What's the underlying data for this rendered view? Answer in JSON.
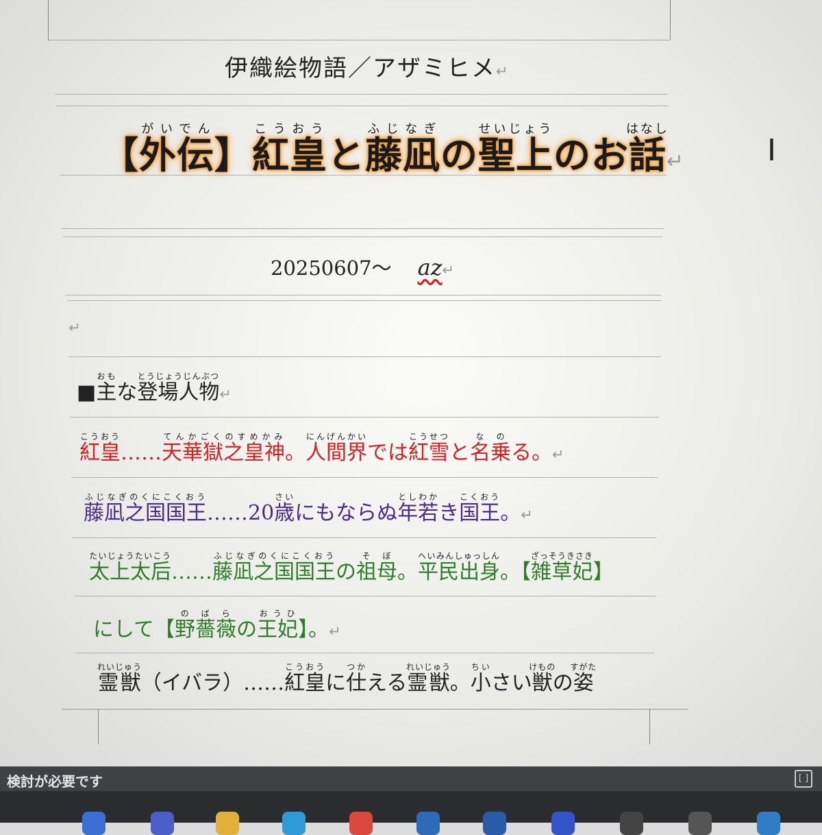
{
  "document": {
    "doc_title": "伊織絵物語／アザミヒメ",
    "heading": [
      {
        "text": "【",
        "ruby": ""
      },
      {
        "text": "外伝",
        "ruby": "がいでん"
      },
      {
        "text": "】",
        "ruby": ""
      },
      {
        "text": "紅皇",
        "ruby": "こうおう"
      },
      {
        "text": "と",
        "ruby": ""
      },
      {
        "text": "藤凪",
        "ruby": "ふじなぎ"
      },
      {
        "text": "の",
        "ruby": ""
      },
      {
        "text": "聖上",
        "ruby": "せいじょう"
      },
      {
        "text": "のお",
        "ruby": ""
      },
      {
        "text": "話",
        "ruby": "はなし"
      }
    ],
    "date": "20250607～",
    "author": "az",
    "paragraph_mark": "↵",
    "section_heading": [
      {
        "text": "■",
        "ruby": ""
      },
      {
        "text": "主",
        "ruby": "おも"
      },
      {
        "text": "な",
        "ruby": ""
      },
      {
        "text": "登場人物",
        "ruby": "とうじょうじんぶつ"
      }
    ],
    "rows": {
      "red": [
        {
          "text": "紅皇",
          "ruby": "こうおう"
        },
        {
          "text": "……",
          "ruby": ""
        },
        {
          "text": "天華獄之皇神",
          "ruby": "てんかごくのすめかみ"
        },
        {
          "text": "。",
          "ruby": ""
        },
        {
          "text": "人間界",
          "ruby": "にんげんかい"
        },
        {
          "text": "では",
          "ruby": ""
        },
        {
          "text": "紅雪",
          "ruby": "こうせつ"
        },
        {
          "text": "と",
          "ruby": ""
        },
        {
          "text": "名乗",
          "ruby": "なの"
        },
        {
          "text": "る。",
          "ruby": ""
        }
      ],
      "purple": [
        {
          "text": "藤凪之国国王",
          "ruby": "ふじなぎのくにこくおう"
        },
        {
          "text": "……20",
          "ruby": ""
        },
        {
          "text": "歳",
          "ruby": "さい"
        },
        {
          "text": "にもならぬ",
          "ruby": ""
        },
        {
          "text": "年若",
          "ruby": "としわか"
        },
        {
          "text": "き",
          "ruby": ""
        },
        {
          "text": "国王",
          "ruby": "こくおう"
        },
        {
          "text": "。",
          "ruby": ""
        }
      ],
      "green1": [
        {
          "text": "太上太后",
          "ruby": "たいじょうたいこう"
        },
        {
          "text": "……",
          "ruby": ""
        },
        {
          "text": "藤凪之国国王",
          "ruby": "ふじなぎのくにこくおう"
        },
        {
          "text": "の",
          "ruby": ""
        },
        {
          "text": "祖母",
          "ruby": "そぼ"
        },
        {
          "text": "。",
          "ruby": ""
        },
        {
          "text": "平民出身",
          "ruby": "へいみんしゅっしん"
        },
        {
          "text": "。【",
          "ruby": ""
        },
        {
          "text": "雑草妃",
          "ruby": "ざっそうきさき"
        },
        {
          "text": "】",
          "ruby": ""
        }
      ],
      "green2": [
        {
          "text": "にして【",
          "ruby": ""
        },
        {
          "text": "野薔薇",
          "ruby": "のばら"
        },
        {
          "text": "の",
          "ruby": ""
        },
        {
          "text": "王妃",
          "ruby": "おうひ"
        },
        {
          "text": "】。",
          "ruby": ""
        }
      ],
      "black": [
        {
          "text": "霊獣",
          "ruby": "れいじゅう"
        },
        {
          "text": "（イバラ）……",
          "ruby": ""
        },
        {
          "text": "紅皇",
          "ruby": "こうおう"
        },
        {
          "text": "に",
          "ruby": ""
        },
        {
          "text": "仕",
          "ruby": "つか"
        },
        {
          "text": "える",
          "ruby": ""
        },
        {
          "text": "霊獣",
          "ruby": "れいじゅう"
        },
        {
          "text": "。",
          "ruby": ""
        },
        {
          "text": "小",
          "ruby": "ちい"
        },
        {
          "text": "さい",
          "ruby": ""
        },
        {
          "text": "獣",
          "ruby": "けもの"
        },
        {
          "text": "の",
          "ruby": ""
        },
        {
          "text": "姿",
          "ruby": "すがた"
        }
      ]
    }
  },
  "status_bar": {
    "text": "検討が必要です",
    "icon": "focus-icon"
  },
  "colors": {
    "glow": "#f19a32",
    "red_text": "#d42222",
    "purple_text": "#4a2a8a",
    "green_text": "#2f7d2a",
    "spell_underline": "#d42020"
  }
}
